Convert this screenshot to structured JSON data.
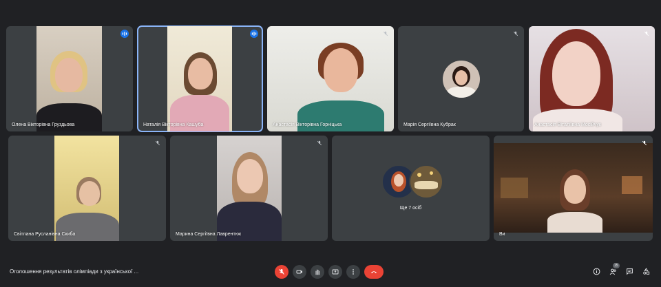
{
  "participants": [
    {
      "name": "Олена Вікторівна Груздьова",
      "mic": "speaking"
    },
    {
      "name": "Наталія Вікторівна Кашуба",
      "mic": "speaking"
    },
    {
      "name": "Анастасія Вікторівна Горніцька",
      "mic": "muted"
    },
    {
      "name": "Марія Сергіївна Кубрак",
      "mic": "muted"
    },
    {
      "name": "Анастасія Віталіївна Мосійчук",
      "mic": "muted"
    },
    {
      "name": "Світлана Русланівна Скиба",
      "mic": "muted"
    },
    {
      "name": "Марина Сергіївна Лаврентюк",
      "mic": "muted"
    },
    {
      "name": "Ви",
      "mic": "muted"
    }
  ],
  "overflow": {
    "label": "Ще 7 осіб"
  },
  "meeting": {
    "title": "Оголошення результатів олімпіади з української ..."
  },
  "controls": [
    "mic-off-icon",
    "camera-icon",
    "raise-hand-icon",
    "present-icon",
    "more-options-icon",
    "end-call-icon"
  ],
  "right_controls": {
    "people_count": "15",
    "icons": [
      "info-icon",
      "people-icon",
      "chat-icon",
      "activities-icon"
    ]
  },
  "colors": {
    "accent": "#1a73e8",
    "end_call": "#ea4335",
    "tile": "#3c4043",
    "background": "#202124"
  }
}
